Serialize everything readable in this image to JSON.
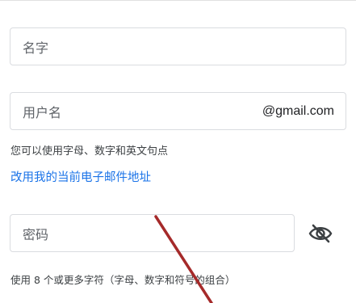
{
  "form": {
    "name_placeholder": "名字",
    "username_placeholder": "用户名",
    "username_suffix": "@gmail.com",
    "username_hint": "您可以使用字母、数字和英文句点",
    "current_email_link": "改用我的当前电子邮件地址",
    "password_placeholder": "密码",
    "password_hint": "使用 8 个或更多字符（字母、数字和符号的组合）"
  },
  "icons": {
    "password_toggle": "eye-off-icon"
  },
  "colors": {
    "link": "#1a73e8",
    "border": "#dadce0",
    "annotation": "#a52a2a"
  }
}
